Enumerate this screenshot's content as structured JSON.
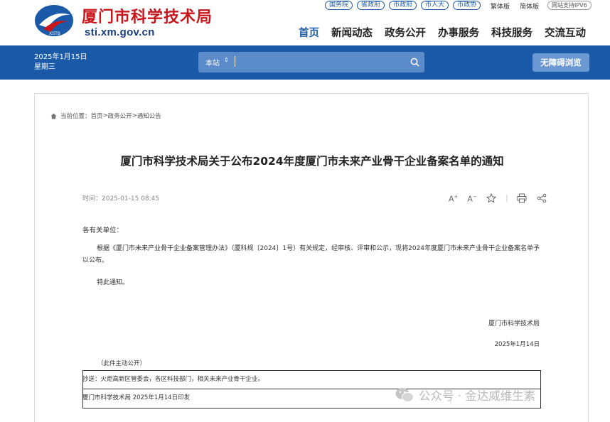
{
  "header": {
    "site_title": "厦门市科学技术局",
    "site_domain": "sti.xm.gov.cn",
    "logo_text": "XSTB",
    "top_links": [
      "国务院",
      "省政府",
      "市政府",
      "市人大",
      "市政协"
    ],
    "lang_links": [
      "繁体版",
      "简体版"
    ],
    "ipv6_label": "网站支持IPV6",
    "nav": [
      "首页",
      "新闻动态",
      "政务公开",
      "办事服务",
      "科技服务",
      "交流互动"
    ]
  },
  "bar": {
    "date": "2025年1月15日",
    "weekday": "星期三",
    "search_scope": "本站",
    "search_placeholder": "",
    "accessibility_label": "无障碍浏览"
  },
  "breadcrumb": {
    "prefix": "当前位置：",
    "items": [
      "首页",
      "政务公开",
      "通知公告"
    ],
    "separator": ">"
  },
  "article": {
    "title": "厦门市科学技术局关于公布2024年度厦门市未来产业骨干企业备案名单的通知",
    "time": "时间：2025-01-15 08:45",
    "tools": {
      "font_larger": "A",
      "font_smaller": "A",
      "larger_mark": "+",
      "smaller_mark": "−"
    },
    "salutation": "各有关单位：",
    "paragraph1": "根据《厦门市未来产业骨干企业备案管理办法》（厦科规〔2024〕1号）有关规定，经审核、评审和公示，现将2024年度厦门市未来产业骨干企业备案名单予以公布。",
    "paragraph2": "特此通知。",
    "sign_org": "厦门市科学技术局",
    "sign_date": "2025年1月14日",
    "public_note": "（此件主动公开）",
    "cc": "抄送：火炬高新区管委会，各区科技部门，相关未来产业骨干企业。",
    "print_line": "厦门市科学技术局  2025年1月14日印发"
  },
  "watermark": {
    "text": "公众号 · 金达威维生素"
  },
  "colors": {
    "brand_blue": "#1b5aa8",
    "title_red": "#c8161d"
  }
}
